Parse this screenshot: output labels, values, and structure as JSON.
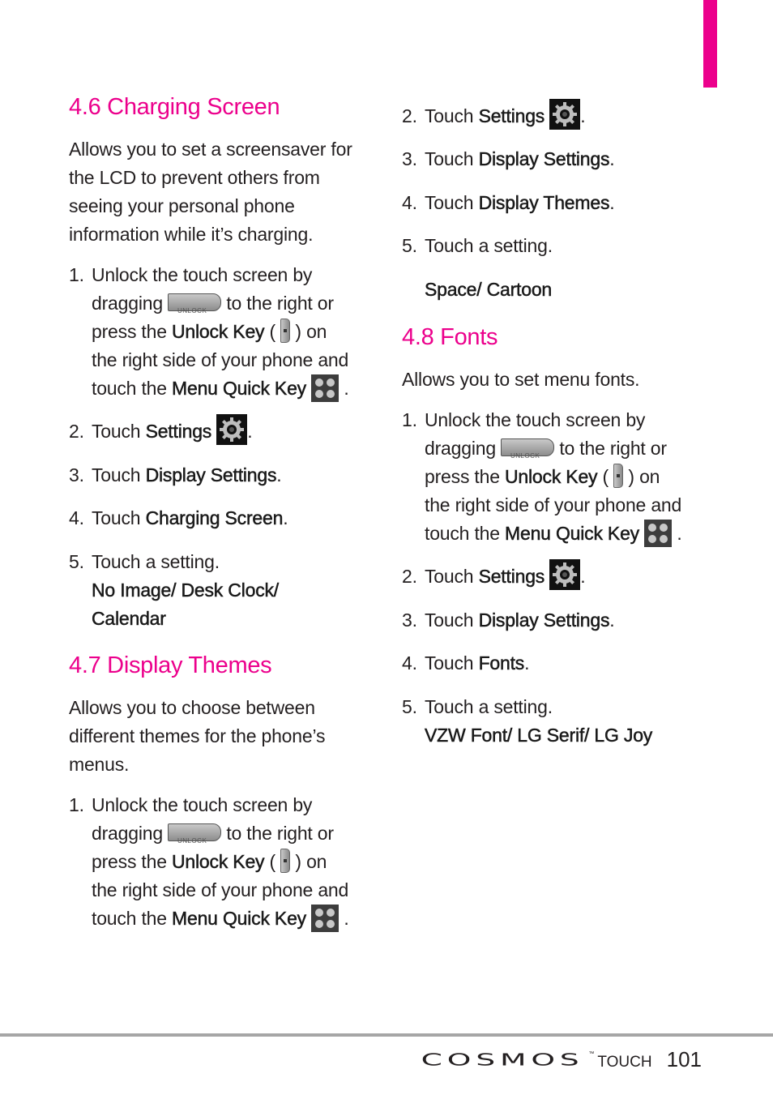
{
  "accent_color": "#ec008c",
  "sections": {
    "charging": {
      "title": "4.6 Charging Screen",
      "intro": [
        "Allows you to set a screensaver for",
        "the LCD to prevent others from",
        "seeing your personal phone",
        "information while it’s charging."
      ],
      "step1": {
        "num": "1.",
        "l1": "Unlock the touch screen by",
        "l2a": "dragging",
        "l2b": "to the right or",
        "l3a": "press the",
        "l3key": "Unlock Key",
        "l3b": "(",
        "l3c": ") on",
        "l4": "the right side of your phone and",
        "l5a": "touch the",
        "l5key": "Menu Quick Key",
        "l5b": "."
      },
      "step2": {
        "num": "2.",
        "text": "Touch",
        "key": "Settings",
        "end": "."
      },
      "step3": {
        "num": "3.",
        "text": "Touch",
        "key": "Display Settings",
        "end": "."
      },
      "step4": {
        "num": "4.",
        "text": "Touch",
        "key": "Charging Screen",
        "end": "."
      },
      "step5": {
        "num": "5.",
        "text": "Touch a setting.",
        "options_l1": "No Image/ Desk Clock/",
        "options_l2": "Calendar"
      }
    },
    "themes": {
      "title": "4.7 Display Themes",
      "intro": [
        "Allows you to choose between",
        "different themes for the phone’s",
        "menus."
      ],
      "step1": {
        "num": "1.",
        "l1": "Unlock the touch screen by",
        "l2a": "dragging",
        "l2b": "to the right or",
        "l3a": "press the",
        "l3key": "Unlock Key",
        "l3b": "(",
        "l3c": ") on",
        "l4": "the right side of your phone and",
        "l5a": "touch the",
        "l5key": "Menu Quick Key",
        "l5b": "."
      },
      "step2": {
        "num": "2.",
        "text": "Touch",
        "key": "Settings",
        "end": "."
      },
      "step3": {
        "num": "3.",
        "text": "Touch",
        "key": "Display Settings",
        "end": "."
      },
      "step4": {
        "num": "4.",
        "text": "Touch",
        "key": "Display Themes",
        "end": "."
      },
      "step5": {
        "num": "5.",
        "text": "Touch a setting.",
        "options_l1": "Space/ Cartoon"
      }
    },
    "fonts": {
      "title": "4.8 Fonts",
      "intro": [
        "Allows you to set menu fonts."
      ],
      "step1": {
        "num": "1.",
        "l1": "Unlock the touch screen by",
        "l2a": "dragging",
        "l2b": "to the right or",
        "l3a": "press the",
        "l3key": "Unlock Key",
        "l3b": "(",
        "l3c": ") on",
        "l4": "the right side of your phone and",
        "l5a": "touch the",
        "l5key": "Menu Quick Key",
        "l5b": "."
      },
      "step2": {
        "num": "2.",
        "text": "Touch",
        "key": "Settings",
        "end": "."
      },
      "step3": {
        "num": "3.",
        "text": "Touch",
        "key": "Display Settings",
        "end": "."
      },
      "step4": {
        "num": "4.",
        "text": "Touch",
        "key": "Fonts",
        "end": "."
      },
      "step5": {
        "num": "5.",
        "text": "Touch a setting.",
        "options_l1": "VZW Font/ LG Serif/ LG Joy"
      }
    }
  },
  "icons": {
    "unlock_slider_label": "UNLOCK"
  },
  "footer": {
    "brand": "COSMOS",
    "trademark": "™",
    "product_suffix": "TOUCH",
    "page_number": "101"
  }
}
